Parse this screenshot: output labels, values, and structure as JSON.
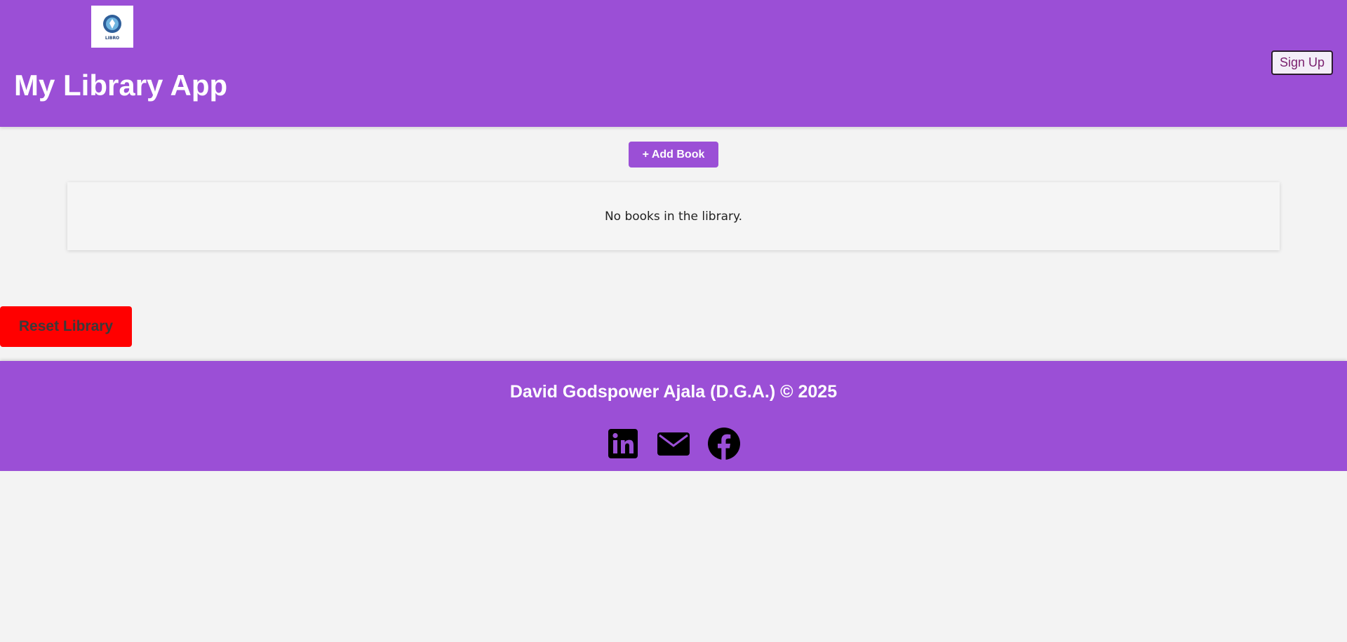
{
  "header": {
    "logo_text": "LIBRO",
    "title": "My Library App",
    "signup_label": "Sign Up"
  },
  "main": {
    "add_book_label": "+ Add Book",
    "empty_message": "No books in the library.",
    "reset_label": "Reset Library"
  },
  "footer": {
    "credit": "David Godspower Ajala (D.G.A.) © 2025",
    "socials": [
      "linkedin-icon",
      "email-icon",
      "facebook-icon"
    ]
  },
  "colors": {
    "brand_purple": "#9b4fd6",
    "background": "#f3f3f3",
    "reset_red": "#ff0000"
  }
}
